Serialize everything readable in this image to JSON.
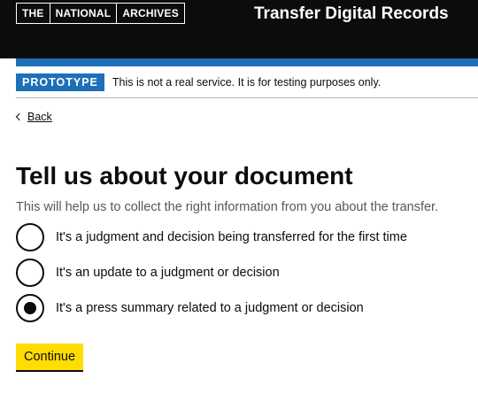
{
  "header": {
    "logo_words": [
      "THE",
      "NATIONAL",
      "ARCHIVES"
    ],
    "service_name": "Transfer Digital Records",
    "colors": {
      "background": "#0b0c0c",
      "accent_bar": "#1d70b8"
    }
  },
  "phase_banner": {
    "tag": "PROTOTYPE",
    "text": "This is not a real service. It is for testing purposes only."
  },
  "back_link": {
    "icon": "chevron-left-icon",
    "label": "Back"
  },
  "main": {
    "heading": "Tell us about your document",
    "hint": "This will help us to collect the right information from you about the transfer.",
    "options": [
      {
        "label": "It's a judgment and decision being transferred for the first time",
        "checked": false
      },
      {
        "label": "It's an update to a judgment or decision",
        "checked": false
      },
      {
        "label": "It's a press summary related to a judgment or decision",
        "checked": true
      }
    ],
    "continue_label": "Continue",
    "button_color": "#ffdd00"
  }
}
